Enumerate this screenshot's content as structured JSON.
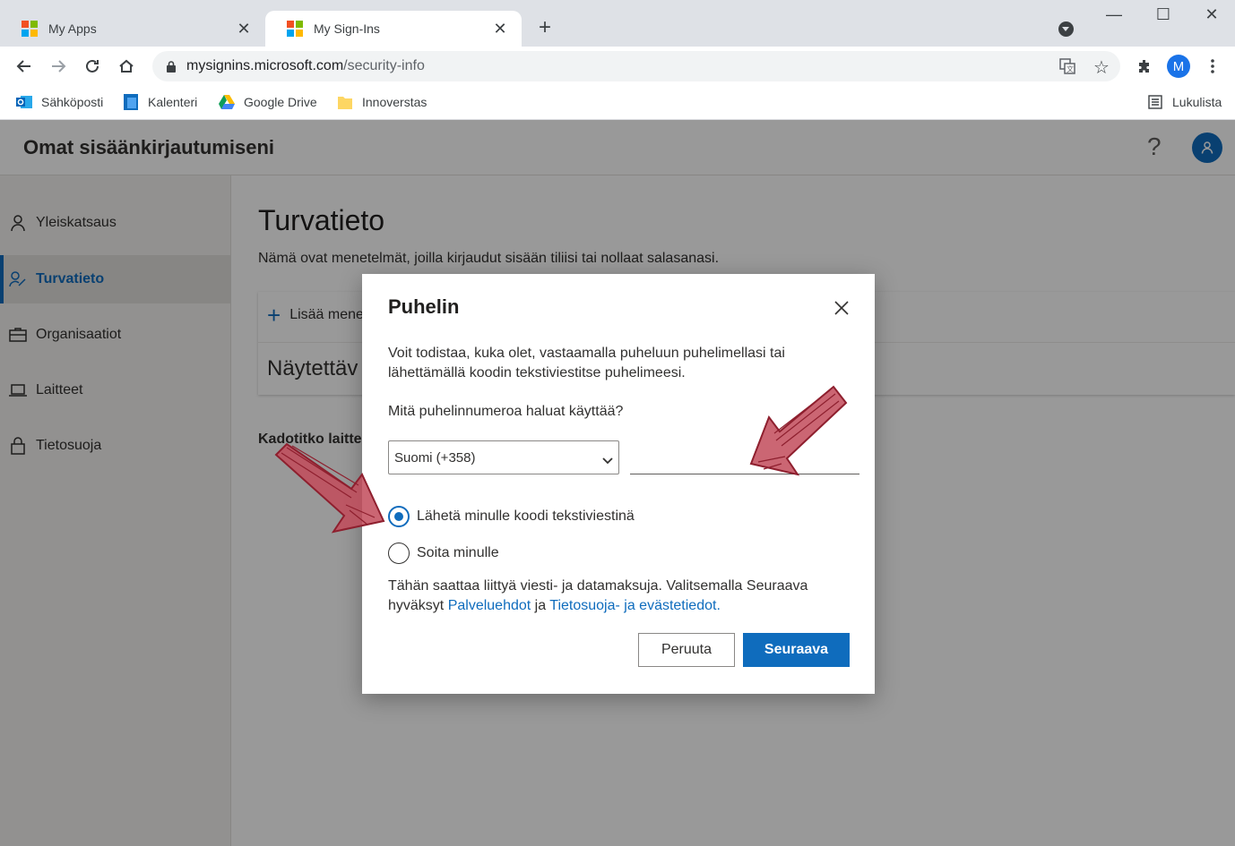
{
  "browser": {
    "tabs": [
      {
        "title": "My Apps",
        "active": false
      },
      {
        "title": "My Sign-Ins",
        "active": true
      }
    ],
    "url": {
      "host": "mysignins.microsoft.com",
      "path": "/security-info"
    },
    "profile_initial": "M",
    "bookmarks": [
      "Sähköposti",
      "Kalenteri",
      "Google Drive",
      "Innoverstas"
    ],
    "reading_list": "Lukulista"
  },
  "app": {
    "title": "Omat sisäänkirjautumiseni",
    "help": "?"
  },
  "sidebar": {
    "items": [
      {
        "label": "Yleiskatsaus",
        "icon": "person-icon"
      },
      {
        "label": "Turvatieto",
        "icon": "security-info-icon",
        "selected": true
      },
      {
        "label": "Organisaatiot",
        "icon": "briefcase-icon"
      },
      {
        "label": "Laitteet",
        "icon": "laptop-icon"
      },
      {
        "label": "Tietosuoja",
        "icon": "lock-icon"
      }
    ]
  },
  "main": {
    "title": "Turvatieto",
    "description": "Nämä ovat menetelmät, joilla kirjaudut sisään tiliisi tai nollaat salasanasi.",
    "add_method": "Lisää mene",
    "default_method": "Näytettäv",
    "lost_device": "Kadotitko laitte"
  },
  "dialog": {
    "title": "Puhelin",
    "intro": "Voit todistaa, kuka olet, vastaamalla puheluun puhelimellasi tai lähettämällä koodin tekstiviestitse puhelimeesi.",
    "question": "Mitä puhelinnumeroa haluat käyttää?",
    "country": "Suomi (+358)",
    "phone_value": "",
    "options": [
      {
        "label": "Lähetä minulle koodi tekstiviestinä",
        "checked": true
      },
      {
        "label": "Soita minulle",
        "checked": false
      }
    ],
    "terms_prefix": "Tähän saattaa liittyä viesti- ja datamaksuja. Valitsemalla Seuraava hyväksyt ",
    "terms_link": "Palveluehdot",
    "terms_mid": " ja ",
    "privacy_link": "Tietosuoja- ja evästetiedot.",
    "cancel_label": "Peruuta",
    "next_label": "Seuraava"
  },
  "colors": {
    "accent": "#0f6cbd",
    "annotation_arrow": "#b3303f"
  }
}
